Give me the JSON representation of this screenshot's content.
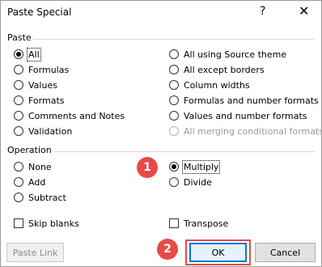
{
  "dialog": {
    "title": "Paste Special",
    "help_glyph": "?",
    "close_glyph": "✕"
  },
  "paste": {
    "heading": "Paste",
    "left": [
      {
        "label": "All",
        "checked": true,
        "disabled": false
      },
      {
        "label": "Formulas",
        "checked": false,
        "disabled": false
      },
      {
        "label": "Values",
        "checked": false,
        "disabled": false
      },
      {
        "label": "Formats",
        "checked": false,
        "disabled": false
      },
      {
        "label": "Comments and Notes",
        "checked": false,
        "disabled": false
      },
      {
        "label": "Validation",
        "checked": false,
        "disabled": false
      }
    ],
    "right": [
      {
        "label": "All using Source theme",
        "checked": false,
        "disabled": false
      },
      {
        "label": "All except borders",
        "checked": false,
        "disabled": false
      },
      {
        "label": "Column widths",
        "checked": false,
        "disabled": false
      },
      {
        "label": "Formulas and number formats",
        "checked": false,
        "disabled": false
      },
      {
        "label": "Values and number formats",
        "checked": false,
        "disabled": false
      },
      {
        "label": "All merging conditional formats",
        "checked": false,
        "disabled": true
      }
    ]
  },
  "operation": {
    "heading": "Operation",
    "left": [
      {
        "label": "None",
        "checked": false
      },
      {
        "label": "Add",
        "checked": false
      },
      {
        "label": "Subtract",
        "checked": false
      }
    ],
    "right": [
      {
        "label": "Multiply",
        "checked": true
      },
      {
        "label": "Divide",
        "checked": false
      }
    ]
  },
  "checkboxes": {
    "skip_blanks": "Skip blanks",
    "transpose": "Transpose"
  },
  "buttons": {
    "paste_link": "Paste Link",
    "ok": "OK",
    "cancel": "Cancel"
  },
  "annotations": {
    "step1": "1",
    "step2": "2"
  },
  "colors": {
    "annotation": "#e84a4a",
    "focus_border": "#0078d7"
  }
}
